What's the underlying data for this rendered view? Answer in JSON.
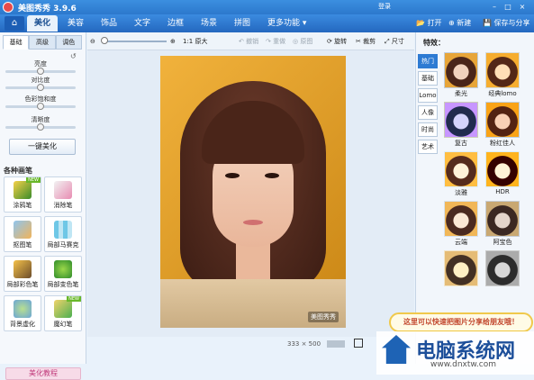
{
  "titlebar": {
    "title": "美图秀秀 3.9.6",
    "login": "登录"
  },
  "nav": {
    "tabs": [
      "美化",
      "美容",
      "饰品",
      "文字",
      "边框",
      "场景",
      "拼图",
      "更多功能 ▾"
    ],
    "right_buttons": [
      "打开",
      "新建",
      "保存与分享"
    ]
  },
  "left": {
    "subtabs": [
      "基础",
      "高级",
      "调色"
    ],
    "sliders": [
      {
        "label": "亮度",
        "value": 0.5
      },
      {
        "label": "对比度",
        "value": 0.5
      },
      {
        "label": "色彩饱和度",
        "value": 0.5
      },
      {
        "label": "清晰度",
        "value": 0.5
      }
    ],
    "one_key": "一键美化",
    "brush_header": "各种画笔",
    "brushes": [
      {
        "label": "涂鸦笔",
        "new": true
      },
      {
        "label": "消除笔",
        "new": false
      },
      {
        "label": "抠图笔",
        "new": false
      },
      {
        "label": "局部马赛克",
        "new": false
      },
      {
        "label": "局部彩色笔",
        "new": false
      },
      {
        "label": "局部变色笔",
        "new": false
      },
      {
        "label": "背景虚化",
        "new": false
      },
      {
        "label": "魔幻笔",
        "new": true
      }
    ],
    "new_badge": "NEW",
    "tutorial": "美化教程"
  },
  "toolbar": {
    "zoom_icon": "magnifier-icon",
    "original": "1:1 原大",
    "undo": "撤销",
    "redo": "重做",
    "reset": "原图",
    "rotate": "旋转",
    "crop": "裁剪",
    "size": "尺寸"
  },
  "canvas": {
    "watermark": "美图秀秀",
    "dimensions": "333 × 500"
  },
  "effects": {
    "header": "特效：",
    "categories": [
      "热门",
      "基础",
      "Lomo",
      "人像",
      "时尚",
      "艺术"
    ],
    "items": [
      "柔光",
      "经典lomo",
      "复古",
      "粉红佳人",
      "淡雅",
      "HDR",
      "云端",
      "阿宝色",
      "",
      ""
    ],
    "hint": "这里可以快速把图片分享给朋友哦！"
  },
  "brand": {
    "name": "电脑系统网",
    "url": "www.dnxtw.com"
  }
}
